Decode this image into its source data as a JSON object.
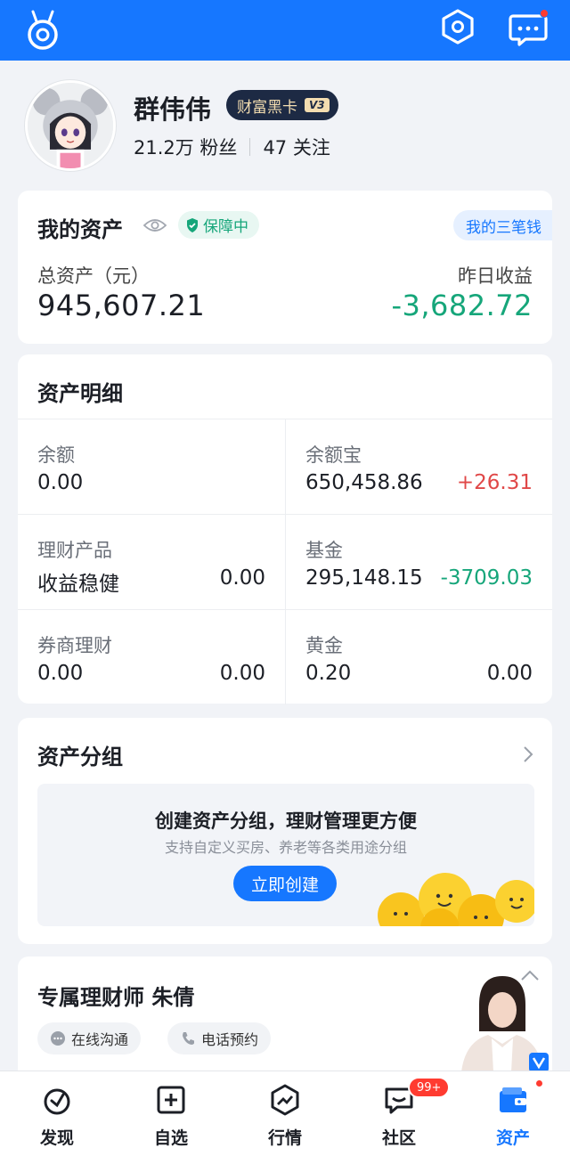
{
  "colors": {
    "brand": "#1677ff",
    "up": "#e04848",
    "down": "#16a67a",
    "vip_bg": "#1d2a44",
    "vip_text": "#f3ddb0"
  },
  "header": {
    "icons": [
      "ant-logo-icon",
      "settings-hexagon-icon",
      "message-icon"
    ]
  },
  "profile": {
    "name": "群伟伟",
    "vip_label": "财富黑卡",
    "vip_level": "V3",
    "followers": "21.2万 粉丝",
    "following": "47 关注"
  },
  "assets": {
    "title": "我的资产",
    "guard_label": "保障中",
    "three_pens": "我的三笔钱",
    "total_label": "总资产（元）",
    "total_value": "945,607.21",
    "yesterday_label": "昨日收益",
    "yesterday_value": "-3,682.72"
  },
  "details": {
    "title": "资产明细",
    "items": [
      {
        "label": "余额",
        "value": "0.00",
        "amount": ""
      },
      {
        "label": "余额宝",
        "value": "650,458.86",
        "amount": "+26.31"
      },
      {
        "label": "理财产品",
        "value": "收益稳健",
        "amount": "0.00"
      },
      {
        "label": "基金",
        "value": "295,148.15",
        "amount": "-3709.03"
      },
      {
        "label": "券商理财",
        "value": "0.00",
        "amount": "0.00"
      },
      {
        "label": "黄金",
        "value": "0.20",
        "amount": "0.00"
      }
    ]
  },
  "groups": {
    "title": "资产分组",
    "promo_title": "创建资产分组，理财管理更方便",
    "promo_sub": "支持自定义买房、养老等各类用途分组",
    "promo_button": "立即创建"
  },
  "advisor": {
    "title": "专属理财师 朱倩",
    "chat_label": "在线沟通",
    "phone_label": "电话预约"
  },
  "tabbar": {
    "tabs": [
      {
        "label": "发现",
        "icon": "discover-icon"
      },
      {
        "label": "自选",
        "icon": "watchlist-add-icon"
      },
      {
        "label": "行情",
        "icon": "market-trend-icon"
      },
      {
        "label": "社区",
        "icon": "community-chat-icon",
        "badge": "99+"
      },
      {
        "label": "资产",
        "icon": "wallet-icon",
        "active": true
      }
    ]
  }
}
